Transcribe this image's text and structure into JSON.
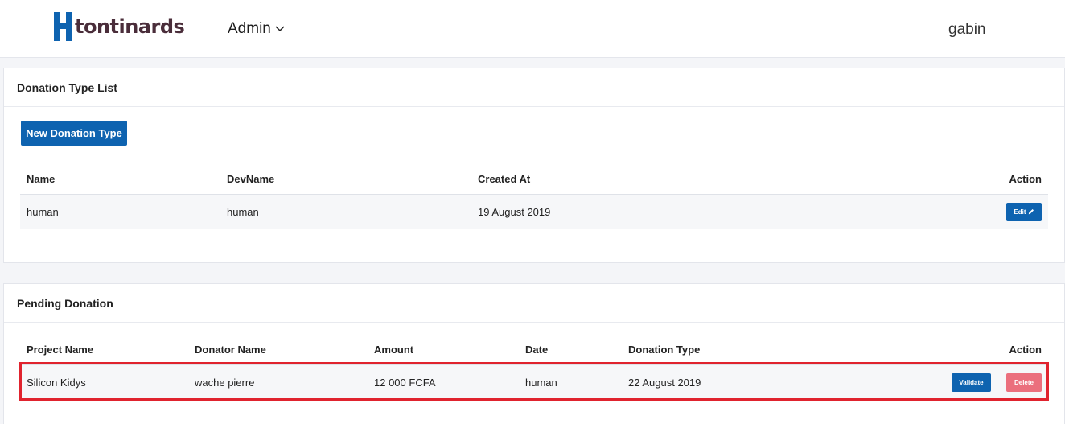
{
  "header": {
    "logo_text": "tontinards",
    "admin_menu_label": "Admin",
    "user_name": "gabin"
  },
  "donation_types": {
    "title": "Donation Type List",
    "new_button_label": "New Donation Type",
    "columns": [
      "Name",
      "DevName",
      "Created At",
      "Action"
    ],
    "rows": [
      {
        "name": "human",
        "dev_name": "human",
        "created_at": "19 August 2019",
        "edit_label": "Edit"
      }
    ]
  },
  "pending_donations": {
    "title": "Pending Donation",
    "columns": [
      "Project Name",
      "Donator Name",
      "Amount",
      "Date",
      "Donation Type",
      "Action"
    ],
    "rows": [
      {
        "project_name": "Silicon Kidys",
        "donator_name": "wache pierre",
        "amount": "12 000 FCFA",
        "date": "human",
        "donation_type": "22 August 2019",
        "validate_label": "Validate",
        "delete_label": "Delete"
      }
    ]
  },
  "colors": {
    "primary": "#0e63b0",
    "danger": "#eb6f7d",
    "highlight": "#e0232e",
    "logo_text": "#4a2d3a"
  },
  "icons": [
    "logo-mark-icon",
    "chevron-down-icon",
    "pencil-icon"
  ]
}
